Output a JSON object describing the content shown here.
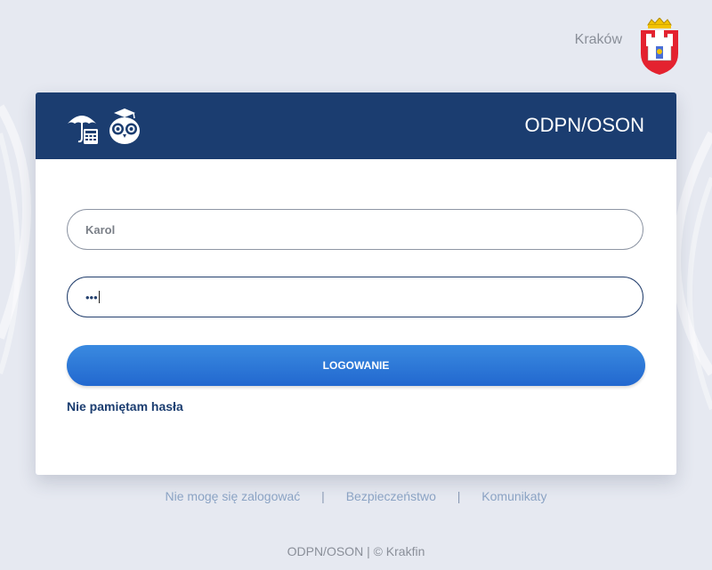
{
  "header": {
    "city": "Kraków",
    "app_title": "ODPN/OSON"
  },
  "form": {
    "username_value": "Karol",
    "password_masked": "•••",
    "login_button": "LOGOWANIE",
    "forgot_password": "Nie pamiętam hasła"
  },
  "footer": {
    "links": [
      "Nie mogę się zalogować",
      "Bezpieczeństwo",
      "Komunikaty"
    ],
    "separator": "|",
    "copyright": "ODPN/OSON | © Krakfin"
  },
  "icons": [
    "umbrella-calculator-icon",
    "owl-icon",
    "krakow-coat-of-arms"
  ],
  "colors": {
    "header_bg": "#1b3d70",
    "button_gradient": [
      "#3a8ae0",
      "#2268cf"
    ],
    "page_bg": "#e6e9f1"
  }
}
